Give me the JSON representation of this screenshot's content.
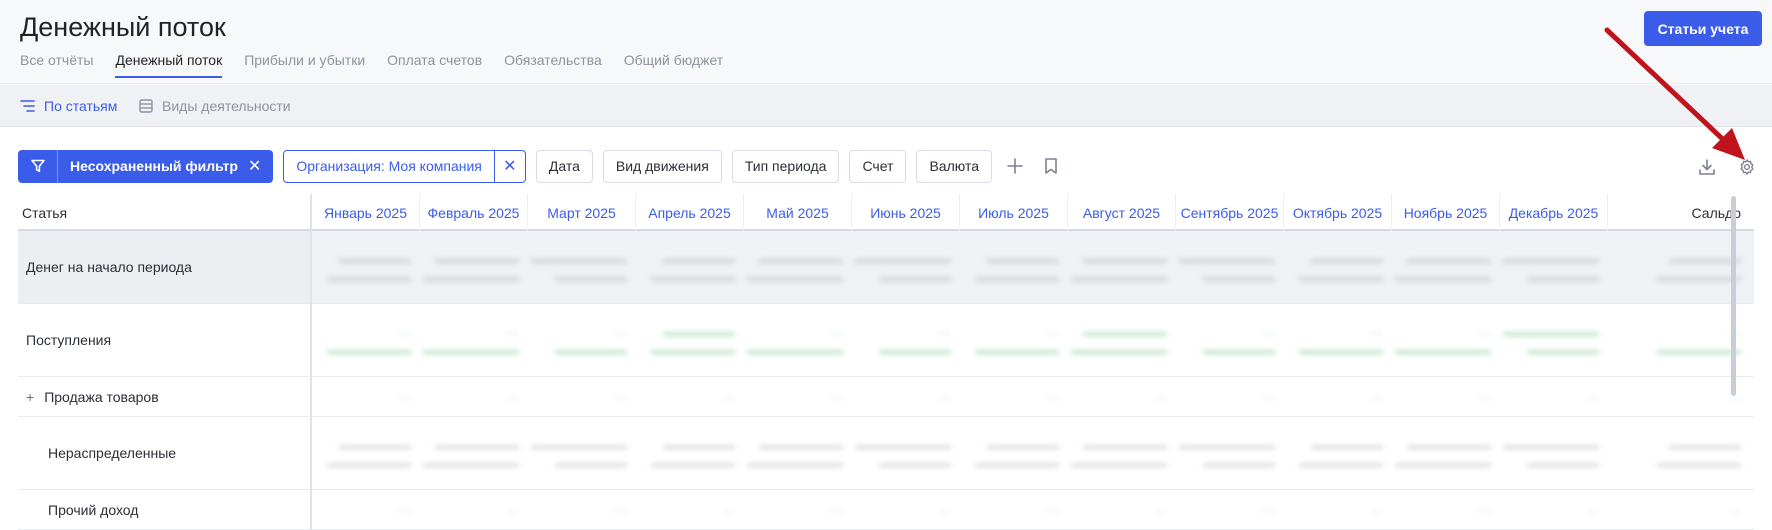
{
  "header": {
    "title": "Денежный поток",
    "accounts_button": "Статьи учета",
    "tabs": [
      {
        "label": "Все отчёты",
        "active": false
      },
      {
        "label": "Денежный поток",
        "active": true
      },
      {
        "label": "Прибыли и убытки",
        "active": false
      },
      {
        "label": "Оплата счетов",
        "active": false
      },
      {
        "label": "Обязательства",
        "active": false
      },
      {
        "label": "Общий бюджет",
        "active": false
      }
    ]
  },
  "subtabs": {
    "by_articles": "По статьям",
    "by_activity": "Виды деятельности"
  },
  "filters": {
    "unsaved": "Несохраненный фильтр",
    "organization": "Организация: Моя компания",
    "chips": [
      "Дата",
      "Вид движения",
      "Тип периода",
      "Счет",
      "Валюта"
    ]
  },
  "table": {
    "label_header": "Статья",
    "months": [
      "Январь 2025",
      "Февраль 2025",
      "Март 2025",
      "Апрель 2025",
      "Май 2025",
      "Июнь 2025",
      "Июль 2025",
      "Август 2025",
      "Сентябрь 2025",
      "Октябрь 2025",
      "Ноябрь 2025",
      "Декабрь 2025"
    ],
    "total_header": "Сальдо",
    "rows": [
      {
        "label": "Денег на начало периода",
        "expand": ""
      },
      {
        "label": "Поступления",
        "expand": ""
      },
      {
        "label": "Продажа товаров",
        "expand": "+"
      },
      {
        "label": "Нераспределенные",
        "expand": ""
      },
      {
        "label": "Прочий доход",
        "expand": ""
      }
    ]
  },
  "colors": {
    "accent": "#3b5ce9",
    "annotation_arrow": "#c0141c",
    "positive": "#2fa84f"
  },
  "icons": {
    "filter": "funnel-icon",
    "add": "plus-icon",
    "bookmark": "bookmark-icon",
    "download": "download-icon",
    "settings": "gear-icon",
    "by_articles": "list-indent-icon",
    "by_activity": "table-icon"
  }
}
